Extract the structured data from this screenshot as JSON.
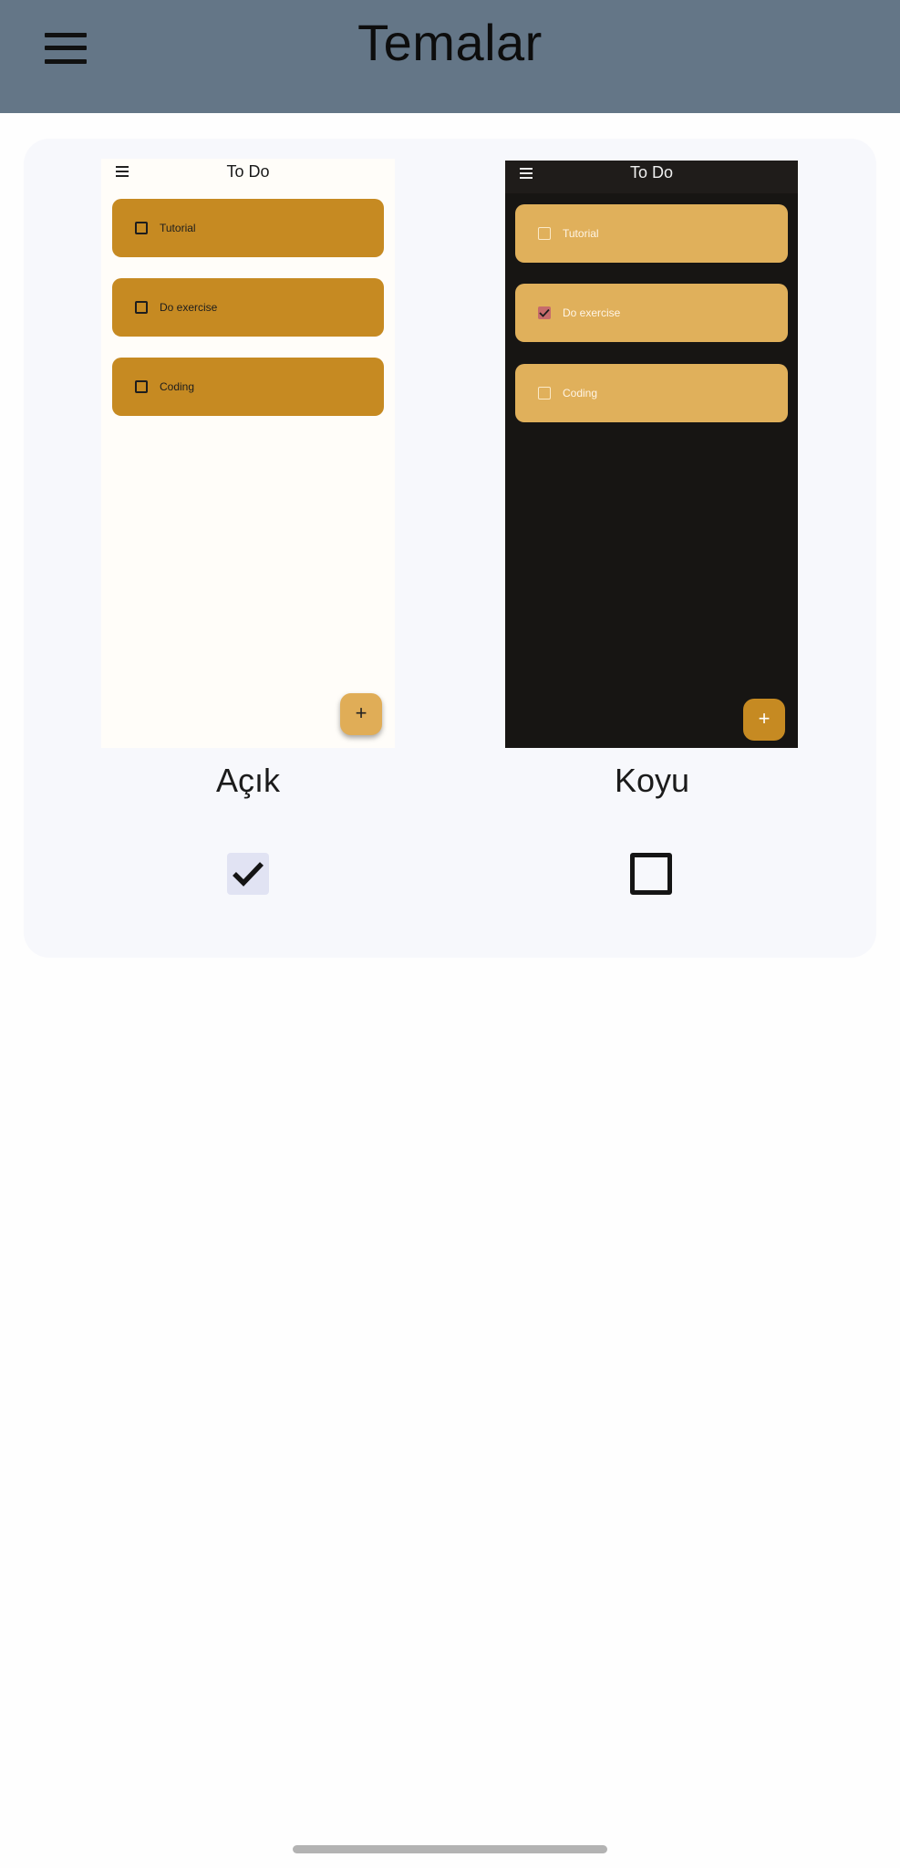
{
  "header": {
    "title": "Temalar",
    "menu_icon": "menu-icon"
  },
  "themes": [
    {
      "id": "light",
      "label": "Açık",
      "selected": true,
      "preview": {
        "title": "To Do",
        "tasks": [
          {
            "label": "Tutorial",
            "done": false
          },
          {
            "label": "Do exercise",
            "done": false
          },
          {
            "label": "Coding",
            "done": false
          }
        ],
        "fab_label": "+",
        "background": "#fffdf9",
        "task_color": "#c68a22",
        "fab_color": "#e0ad57"
      }
    },
    {
      "id": "dark",
      "label": "Koyu",
      "selected": false,
      "preview": {
        "title": "To Do",
        "tasks": [
          {
            "label": "Tutorial",
            "done": false
          },
          {
            "label": "Do exercise",
            "done": true
          },
          {
            "label": "Coding",
            "done": false
          }
        ],
        "fab_label": "+",
        "background": "#171513",
        "task_color": "#e0b05b",
        "fab_color": "#c68a22"
      }
    }
  ],
  "colors": {
    "appbar": "#647687",
    "card": "#f7f8fc",
    "selected_checkbox": "#e1e3f3"
  }
}
